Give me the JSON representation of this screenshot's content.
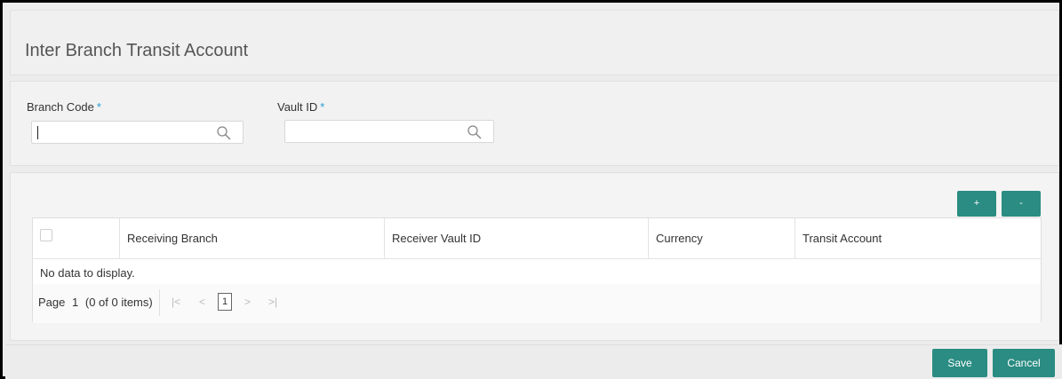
{
  "page": {
    "title": "Inter Branch Transit Account"
  },
  "criteria": {
    "branch_code": {
      "label": "Branch Code",
      "required": "*",
      "value": ""
    },
    "vault_id": {
      "label": "Vault ID",
      "required": "*",
      "value": ""
    }
  },
  "grid": {
    "add_label": "+",
    "remove_label": "-",
    "columns": [
      "Receiving Branch",
      "Receiver Vault ID",
      "Currency",
      "Transit Account"
    ],
    "empty_message": "No data to display.",
    "pager": {
      "page_label": "Page",
      "page_number": "1",
      "items_text": "(0 of 0 items)",
      "current_page": "1",
      "first": "|<",
      "prev": "<",
      "next": ">",
      "last": ">|"
    }
  },
  "footer": {
    "save_label": "Save",
    "cancel_label": "Cancel"
  },
  "colors": {
    "accent": "#2a8c82",
    "required": "#2a9fd6"
  }
}
